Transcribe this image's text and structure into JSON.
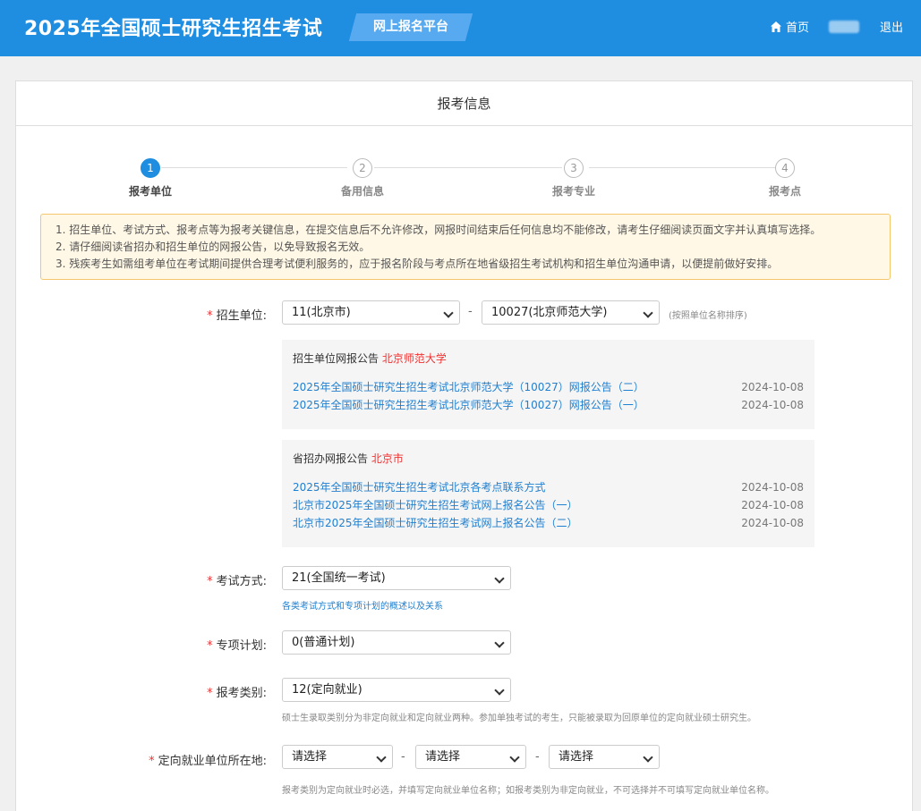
{
  "header": {
    "title": "2025年全国硕士研究生招生考试",
    "platform": "网上报名平台",
    "home": "首页",
    "logout": "退出"
  },
  "card": {
    "title": "报考信息"
  },
  "steps": [
    {
      "num": "1",
      "label": "报考单位"
    },
    {
      "num": "2",
      "label": "备用信息"
    },
    {
      "num": "3",
      "label": "报考专业"
    },
    {
      "num": "4",
      "label": "报考点"
    }
  ],
  "current_step": 1,
  "notice": [
    "1. 招生单位、考试方式、报考点等为报考关键信息，在提交信息后不允许修改，网报时间结束后任何信息均不能修改，请考生仔细阅读页面文字并认真填写选择。",
    "2. 请仔细阅读省招办和招生单位的网报公告，以免导致报名无效。",
    "3. 残疾考生如需组考单位在考试期间提供合理考试便利服务的，应于报名阶段与考点所在地省级招生考试机构和招生单位沟通申请，以便提前做好安排。"
  ],
  "form": {
    "unit": {
      "label": "招生单位:",
      "province": "11(北京市)",
      "school": "10027(北京师范大学)",
      "hint": "(按照单位名称排序)"
    },
    "unit_announcements": {
      "title": "招生单位网报公告",
      "name": "北京师范大学",
      "items": [
        {
          "text": "2025年全国硕士研究生招生考试北京师范大学（10027）网报公告（二）",
          "date": "2024-10-08"
        },
        {
          "text": "2025年全国硕士研究生招生考试北京师范大学（10027）网报公告（一）",
          "date": "2024-10-08"
        }
      ]
    },
    "province_announcements": {
      "title": "省招办网报公告",
      "name": "北京市",
      "items": [
        {
          "text": "2025年全国硕士研究生招生考试北京各考点联系方式",
          "date": "2024-10-08"
        },
        {
          "text": "北京市2025年全国硕士研究生招生考试网上报名公告（一）",
          "date": "2024-10-08"
        },
        {
          "text": "北京市2025年全国硕士研究生招生考试网上报名公告（二）",
          "date": "2024-10-08"
        }
      ]
    },
    "exam_mode": {
      "label": "考试方式:",
      "value": "21(全国统一考试)",
      "link": "各类考试方式和专项计划的概述以及关系"
    },
    "special_plan": {
      "label": "专项计划:",
      "value": "0(普通计划)"
    },
    "category": {
      "label": "报考类别:",
      "value": "12(定向就业)",
      "hint": "硕士生录取类别分为非定向就业和定向就业两种。参加单独考试的考生，只能被录取为回原单位的定向就业硕士研究生。"
    },
    "employer_location": {
      "label": "定向就业单位所在地:",
      "sel1": "请选择",
      "sel2": "请选择",
      "sel3": "请选择",
      "hint": "报考类别为定向就业时必选，并填写定向就业单位名称；如报考类别为非定向就业，不可选择并不可填写定向就业单位名称。"
    }
  },
  "colors": {
    "primary": "#1f8de0",
    "required": "#e33333",
    "link": "#1f7fd0"
  }
}
